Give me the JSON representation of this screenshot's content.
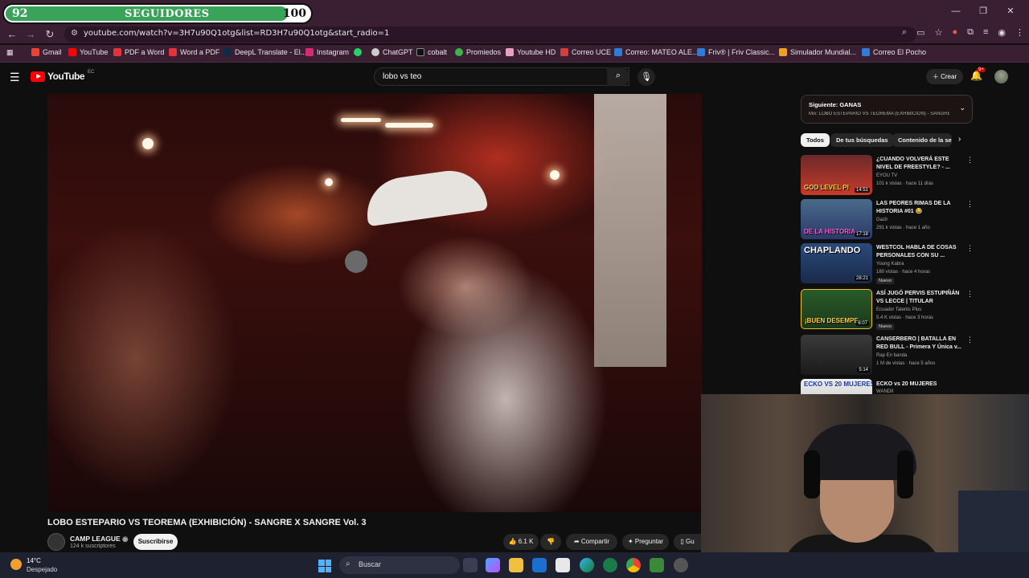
{
  "followers": {
    "start": "92",
    "title": "SEGUIDORES",
    "end": "100",
    "progress": 0.92
  },
  "browser": {
    "url": "youtube.com/watch?v=3H7u90Q1otg&list=RD3H7u90Q1otg&start_radio=1",
    "bookmarks": [
      "Gmail",
      "YouTube",
      "PDF a Word",
      "Word a PDF",
      "DeepL Translate - El...",
      "Instagram",
      "ChatGPT",
      "cobalt",
      "Promiedos",
      "Youtube HD",
      "Correo UCE",
      "Correo: MATEO ALE...",
      "Friv® | Friv Classic...",
      "Simulador Mundial...",
      "Correo El Pocho"
    ]
  },
  "youtube": {
    "search_value": "lobo vs teo",
    "create_label": "Crear",
    "notif_count": "9+",
    "logo_text": "YouTube",
    "logo_region": "EC"
  },
  "video": {
    "title": "LOBO ESTEPARIO VS TEOREMA (EXHIBICIÓN) - SANGRE X SANGRE Vol. 3",
    "channel": "CAMP LEAGUE",
    "subscribers": "124 k suscriptores",
    "subscribe_label": "Suscribirse",
    "likes": "6.1 K",
    "share_label": "Compartir",
    "ask_label": "Preguntar",
    "save_label": "Gu"
  },
  "sidebar": {
    "next_title": "Siguiente: GANAS",
    "next_sub": "Mix: LOBO ESTEPARIO VS TEOREMA (EXHIBICIÓN) - SANGRE X SANGR...",
    "chips": [
      "Todos",
      "De tus búsquedas",
      "Contenido de la ser"
    ],
    "recs": [
      {
        "title": "¿CUANDO VOLVERÁ ESTE NIVEL DE FREESTYLE? - ...",
        "channel": "EYOU TV",
        "meta": "101 k vistas · hace 11 días",
        "duration": "14:51",
        "caption": "GOD LEVEL PI",
        "new": ""
      },
      {
        "title": "LAS PEORES RIMAS DE LA HISTORIA #01 😂",
        "channel": "Gazir",
        "meta": "291 k vistas · hace 1 año",
        "duration": "17:18",
        "caption": "DE LA HISTORIA",
        "new": ""
      },
      {
        "title": "WESTCOL HABLA DE COSAS PERSONALES CON SU ...",
        "channel": "Young Kabra",
        "meta": "180 vistas · hace 4 horas",
        "duration": "28:21",
        "caption": "CHAPLANDO",
        "new": "Nuevo"
      },
      {
        "title": "ASÍ JUGÓ PERVIS ESTUPIÑÁN VS LECCE | TITULAR",
        "channel": "Ecuador Talents Plus",
        "meta": "5.4 K vistas · hace 3 horas",
        "duration": "6:07",
        "caption": "¡BUEN DESEMPE",
        "new": "Nuevo"
      },
      {
        "title": "CANSERBERO | BATALLA EN RED BULL - Primera Y Única v...",
        "channel": "Rap En banda",
        "meta": "1 M de vistas · hace 5 años",
        "duration": "5:14",
        "caption": "",
        "new": ""
      },
      {
        "title": "ECKO vs 20 MUJERES",
        "channel": "WANDII",
        "meta": "",
        "duration": "",
        "caption": "ECKO VS 20 MUJERES",
        "new": ""
      }
    ]
  },
  "taskbar": {
    "temp": "14°C",
    "condition": "Despejado",
    "search_placeholder": "Buscar"
  },
  "colors": {
    "accent": "#3aa35a",
    "yt_red": "#ff0000",
    "chrome": "#3a1f33"
  }
}
